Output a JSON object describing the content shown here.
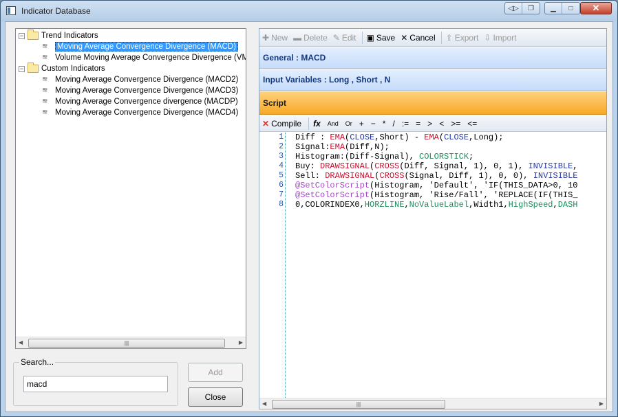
{
  "window": {
    "title": "Indicator Database"
  },
  "tree": {
    "groups": [
      {
        "label": "Trend Indicators",
        "items": [
          "Moving Average Convergence Divergence (MACD)",
          "Volume Moving Average Convergence Divergence (VMACD)"
        ]
      },
      {
        "label": "Custom Indicators",
        "items": [
          "Moving Average Convergence Divergence (MACD2)",
          "Moving Average Convergence Divergence (MACD3)",
          "Moving Average Convergence divergence (MACDP)",
          "Moving Average Convergence Divergence (MACD4)"
        ]
      }
    ],
    "selected_item": "Moving Average Convergence Divergence (MACD)"
  },
  "search": {
    "legend": "Search...",
    "value": "macd"
  },
  "buttons": {
    "add": "Add",
    "close": "Close"
  },
  "toolbar": {
    "new": "New",
    "delete": "Delete",
    "edit": "Edit",
    "save": "Save",
    "cancel": "Cancel",
    "export": "Export",
    "import": "Import"
  },
  "sections": {
    "general": "General : MACD",
    "inputs": "Input Variables : Long , Short , N",
    "script": "Script"
  },
  "script_toolbar": {
    "compile": "Compile",
    "fx": "fx",
    "and": "And",
    "or": "Or",
    "ops": [
      "+",
      "−",
      "*",
      "/",
      ":=",
      "=",
      ">",
      "<",
      ">=",
      "<="
    ]
  },
  "code": {
    "line_numbers": [
      "1",
      "2",
      "3",
      "4",
      "5",
      "6",
      "7",
      "8"
    ],
    "lines": [
      "Diff : EMA(CLOSE,Short) - EMA(CLOSE,Long);",
      "Signal:EMA(Diff,N);",
      "Histogram:(Diff-Signal), COLORSTICK;",
      "Buy: DRAWSIGNAL(CROSS(Diff, Signal, 1), 0, 1), INVISIBLE,",
      "Sell: DRAWSIGNAL(CROSS(Signal, Diff, 1), 0, 0), INVISIBLE",
      "@SetColorScript(Histogram, 'Default', 'IF(THIS_DATA>0, 10",
      "@SetColorScript(Histogram, 'Rise/Fall', 'REPLACE(IF(THIS_",
      "0,COLORINDEX0,HORZLINE,NoValueLabel,Width1,HighSpeed,DASH"
    ]
  },
  "colors": {
    "title_bar": "#b9d1ea",
    "section_blue": "#c6dcfa",
    "section_orange": "#f7a828",
    "selection": "#3399ff"
  }
}
